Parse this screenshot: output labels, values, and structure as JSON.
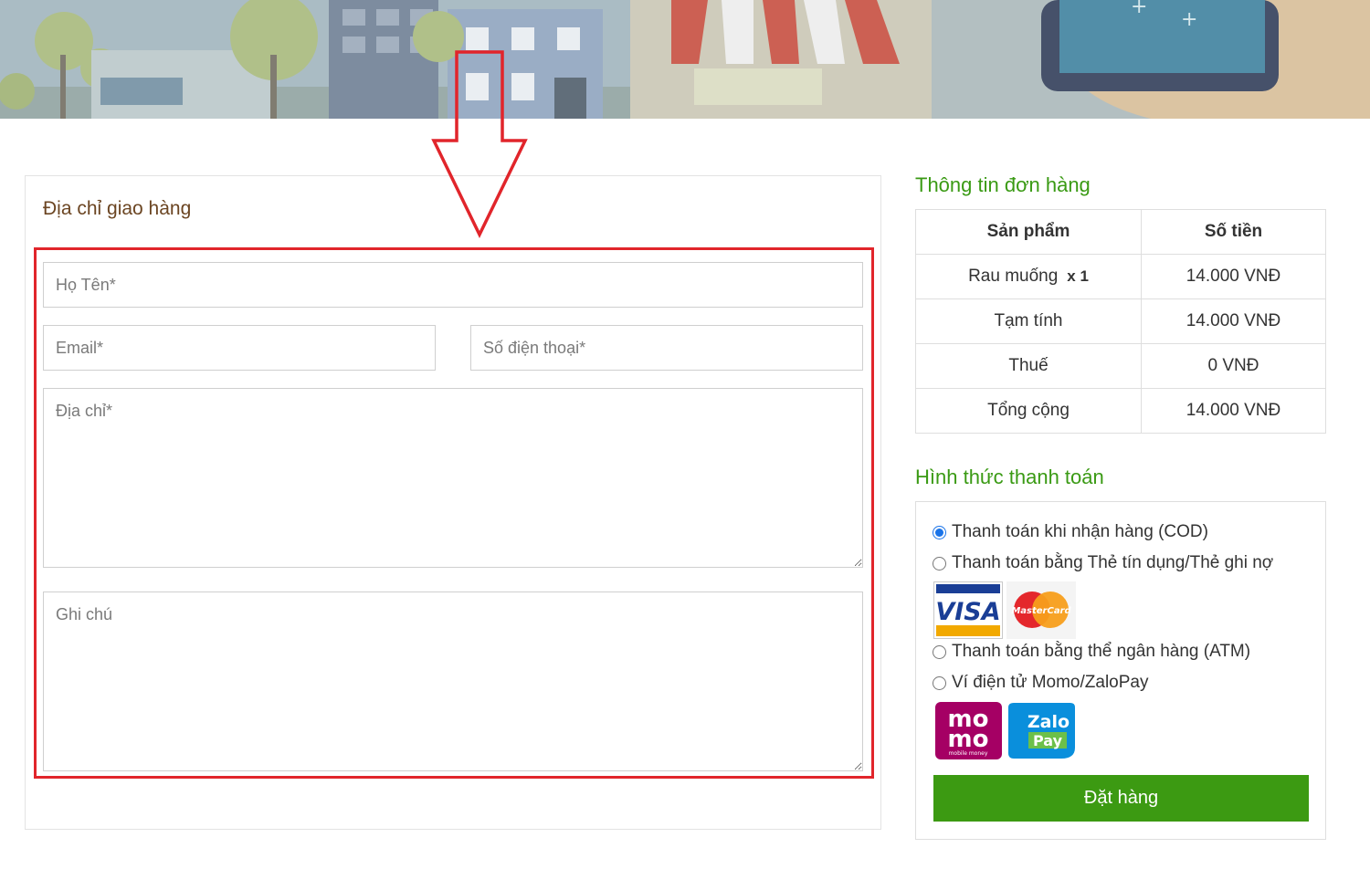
{
  "shipping": {
    "title": "Địa chỉ giao hàng",
    "name_placeholder": "Họ Tên*",
    "email_placeholder": "Email*",
    "phone_placeholder": "Số điện thoại*",
    "address_placeholder": "Địa chỉ*",
    "note_placeholder": "Ghi chú"
  },
  "order": {
    "title": "Thông tin đơn hàng",
    "headers": [
      "Sản phẩm",
      "Số tiền"
    ],
    "item_name": "Rau muống",
    "item_qty": "x 1",
    "item_price": "14.000 VNĐ",
    "subtotal_label": "Tạm tính",
    "subtotal_value": "14.000 VNĐ",
    "tax_label": "Thuế",
    "tax_value": "0 VNĐ",
    "total_label": "Tổng cộng",
    "total_value": "14.000 VNĐ"
  },
  "payment": {
    "title": "Hình thức thanh toán",
    "options": [
      {
        "label": "Thanh toán khi nhận hàng (COD)",
        "checked": true
      },
      {
        "label": "Thanh toán bằng Thẻ tín dụng/Thẻ ghi nợ",
        "checked": false
      },
      {
        "label": "Thanh toán bằng thể ngân hàng (ATM)",
        "checked": false
      },
      {
        "label": "Ví điện tử Momo/ZaloPay",
        "checked": false
      }
    ],
    "logos": {
      "visa": "VISA",
      "mastercard": "MasterCard",
      "momo_top": "mo",
      "momo_bottom": "mo",
      "momo_caption": "mobile money",
      "zalo_top": "Zalo",
      "zalo_bottom": "Pay"
    },
    "submit_label": "Đặt hàng"
  },
  "colors": {
    "accent_green": "#3c9a12",
    "heading_green": "#3a9a14",
    "highlight_red": "#e1252b",
    "shipping_title_brown": "#6b4522"
  }
}
